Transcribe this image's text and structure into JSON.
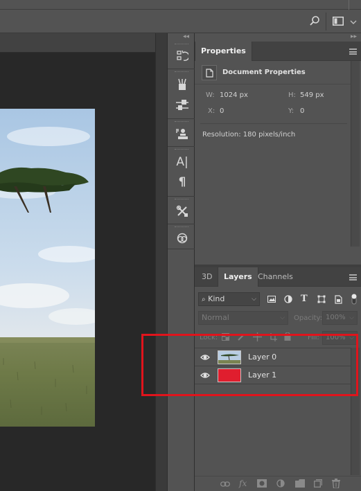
{
  "options_bar": {
    "icons": [
      "search-icon",
      "workspace-icon",
      "chevron-down-icon"
    ]
  },
  "toolstrip": {
    "collapse_glyph": "◂◂",
    "tools": [
      {
        "name": "history-icon"
      },
      {
        "name": "brush-presets-icon"
      },
      {
        "name": "brush-settings-icon"
      },
      {
        "name": "clone-source-icon"
      },
      {
        "name": "character-icon",
        "glyph": "A|"
      },
      {
        "name": "paragraph-icon",
        "glyph": "¶"
      },
      {
        "name": "tool-presets-icon"
      },
      {
        "name": "libraries-icon"
      }
    ]
  },
  "properties": {
    "tab": "Properties",
    "header": "Document Properties",
    "w_label": "W:",
    "w_value": "1024 px",
    "h_label": "H:",
    "h_value": "549 px",
    "x_label": "X:",
    "x_value": "0",
    "y_label": "Y:",
    "y_value": "0",
    "resolution": "Resolution: 180 pixels/inch"
  },
  "layers_panel": {
    "tabs": [
      "3D",
      "Layers",
      "Channels"
    ],
    "active_tab": "Layers",
    "filter_kind": "Kind",
    "filter_icons": [
      "image-filter-icon",
      "adjustment-filter-icon",
      "type-filter-icon",
      "shape-filter-icon",
      "smart-object-filter-icon",
      "filter-toggle-icon"
    ],
    "blend_mode": "Normal",
    "opacity_label": "Opacity:",
    "opacity_value": "100%",
    "lock_label": "Lock:",
    "fill_label": "Fill:",
    "fill_value": "100%",
    "layers": [
      {
        "name": "Layer 0",
        "visible": true,
        "thumb": "image"
      },
      {
        "name": "Layer 1",
        "visible": true,
        "thumb": "#e01e2e"
      }
    ],
    "bottom_icons": [
      "link-icon",
      "fx-icon",
      "mask-icon",
      "adjustment-icon",
      "group-icon",
      "new-layer-icon",
      "trash-icon"
    ],
    "fx_glyph": "fx"
  },
  "colors": {
    "highlight": "#e0141c",
    "layer1_fill": "#e01e2e"
  }
}
